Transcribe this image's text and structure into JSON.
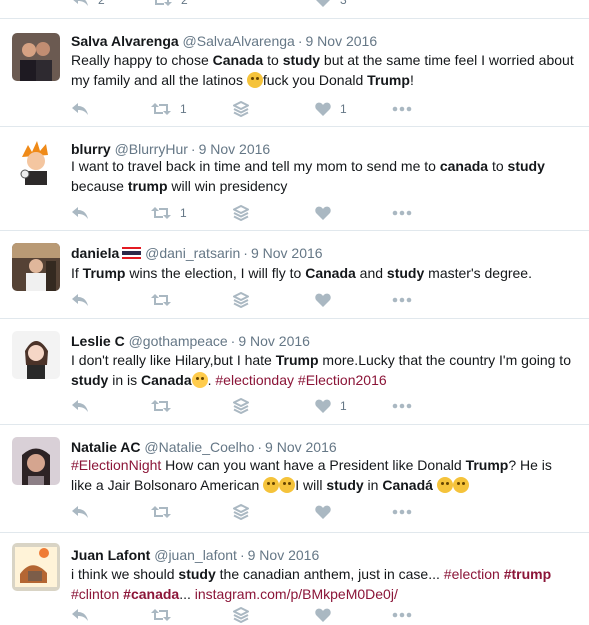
{
  "top_counts": {
    "reply": "2",
    "retweet": "2",
    "like": "3"
  },
  "tweets": [
    {
      "name": "Salva Alvarenga",
      "handle": "@SalvaAlvarenga",
      "time": "9 Nov 2016",
      "text_parts": [
        {
          "t": "Really happy to chose "
        },
        {
          "t": "Canada",
          "b": true
        },
        {
          "t": " to "
        },
        {
          "t": "study",
          "b": true
        },
        {
          "t": " but at the same time feel I worried about my family and all the latinos "
        },
        {
          "emoji": "sad-face"
        },
        {
          "t": "fuck you Donald "
        },
        {
          "t": "Trump",
          "b": true
        },
        {
          "t": "!"
        }
      ],
      "retweets": "1",
      "likes": "1"
    },
    {
      "name": "blurry",
      "handle": "@BlurryHur",
      "time": "9 Nov 2016",
      "text_parts": [
        {
          "t": "I want to travel back in time and tell my mom to send me to "
        },
        {
          "t": "canada",
          "b": true
        },
        {
          "t": " to "
        },
        {
          "t": "study",
          "b": true
        },
        {
          "t": " because "
        },
        {
          "t": "trump",
          "b": true
        },
        {
          "t": " will win presidency"
        }
      ],
      "retweets": "1",
      "likes": ""
    },
    {
      "name": "daniela",
      "flag": true,
      "handle": "@dani_ratsarin",
      "time": "9 Nov 2016",
      "text_parts": [
        {
          "t": "If "
        },
        {
          "t": "Trump",
          "b": true
        },
        {
          "t": " wins the election, I will fly to "
        },
        {
          "t": "Canada",
          "b": true
        },
        {
          "t": " and "
        },
        {
          "t": "study",
          "b": true
        },
        {
          "t": " master's degree."
        }
      ],
      "retweets": "",
      "likes": ""
    },
    {
      "name": "Leslie C",
      "handle": "@gothampeace",
      "time": "9 Nov 2016",
      "text_parts": [
        {
          "t": "I don't really like Hilary,but I hate "
        },
        {
          "t": "Trump",
          "b": true
        },
        {
          "t": " more.Lucky that the country I'm going to "
        },
        {
          "t": "study",
          "b": true
        },
        {
          "t": " in is "
        },
        {
          "t": "Canada",
          "b": true
        },
        {
          "emoji": "scream"
        },
        {
          "t": ". "
        },
        {
          "t": "#electionday",
          "tag": true
        },
        {
          "t": " "
        },
        {
          "t": "#Election2016",
          "tag": true
        }
      ],
      "retweets": "",
      "likes": "1"
    },
    {
      "name": "Natalie AC",
      "handle": "@Natalie_Coelho",
      "time": "9 Nov 2016",
      "text_parts": [
        {
          "t": "#ElectionNight",
          "tag": true
        },
        {
          "t": "  How can you want have a President like Donald "
        },
        {
          "t": "Trump",
          "b": true
        },
        {
          "t": "? He is like a Jair Bolsonaro American "
        },
        {
          "emoji": "sad-face"
        },
        {
          "emoji": "crying-face"
        },
        {
          "t": "I will "
        },
        {
          "t": "study",
          "b": true
        },
        {
          "t": " in "
        },
        {
          "t": "Canadá",
          "b": true
        },
        {
          "t": " "
        },
        {
          "emoji": "frowning-face"
        },
        {
          "emoji": "grimacing-face"
        }
      ],
      "retweets": "",
      "likes": ""
    },
    {
      "name": "Juan Lafont",
      "handle": "@juan_lafont",
      "time": "9 Nov 2016",
      "text_parts": [
        {
          "t": "i think we should "
        },
        {
          "t": "study",
          "b": true
        },
        {
          "t": " the canadian anthem, just in case... "
        },
        {
          "t": "#election",
          "tag": true
        },
        {
          "t": " "
        },
        {
          "t": "#trump",
          "tag": true,
          "b": true
        },
        {
          "t": " "
        },
        {
          "t": "#clinton",
          "tag": true
        },
        {
          "t": " "
        },
        {
          "t": "#canada",
          "tag": true,
          "b": true
        },
        {
          "t": "... "
        },
        {
          "t": "instagram.com/p/BMkpeM0De0j/",
          "link": true
        }
      ],
      "retweets": "",
      "likes": ""
    }
  ]
}
